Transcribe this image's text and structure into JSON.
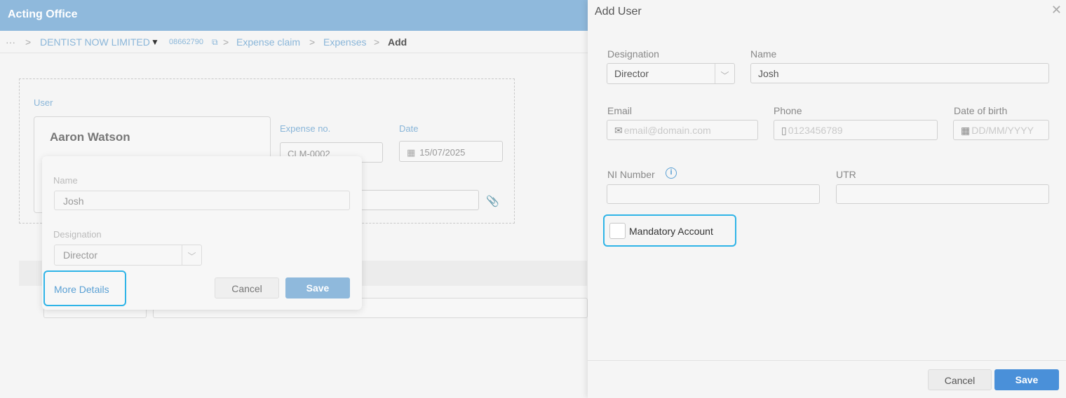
{
  "app": {
    "title": "Acting Office"
  },
  "breadcrumb": {
    "ellipsis": "···",
    "company": "DENTIST NOW LIMITED",
    "company_number": "08662790",
    "items": [
      "Expense claim",
      "Expenses",
      "Add"
    ]
  },
  "form": {
    "user_label": "User",
    "user_name": "Aaron Watson",
    "expense_no_label": "Expense no.",
    "expense_no_value": "CLM-0002",
    "date_label": "Date",
    "date_value": "15/07/2025"
  },
  "popover": {
    "name_label": "Name",
    "name_value": "Josh",
    "designation_label": "Designation",
    "designation_value": "Director",
    "more_details": "More Details",
    "cancel": "Cancel",
    "save": "Save"
  },
  "panel": {
    "title": "Add User",
    "designation_label": "Designation",
    "designation_value": "Director",
    "name_label": "Name",
    "name_value": "Josh",
    "email_label": "Email",
    "email_placeholder": "email@domain.com",
    "phone_label": "Phone",
    "phone_placeholder": "0123456789",
    "dob_label": "Date of birth",
    "dob_placeholder": "DD/MM/YYYY",
    "ni_label": "NI Number",
    "utr_label": "UTR",
    "mandatory_label": "Mandatory Account",
    "cancel": "Cancel",
    "save": "Save"
  },
  "icons": {
    "chevron": "chevron-down-icon",
    "external": "external-link-icon",
    "calendar": "calendar-icon",
    "attach": "paperclip-icon",
    "mail": "mail-icon",
    "phone": "phone-icon",
    "info": "info-icon",
    "close": "close-icon"
  },
  "colors": {
    "topbar": "#8fb9dc",
    "accent": "#4a90d9",
    "focus": "#2fb4e7",
    "link": "#5aa0d4"
  }
}
